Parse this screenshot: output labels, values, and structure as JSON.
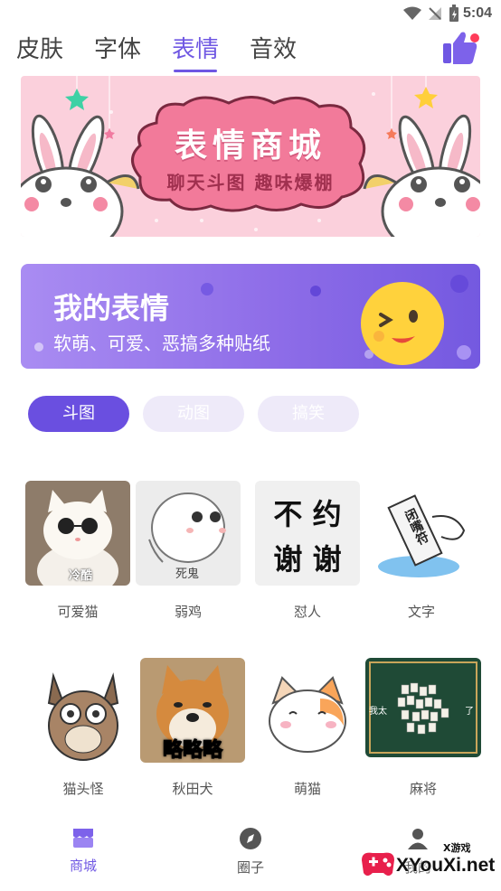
{
  "status_bar": {
    "time": "5:04"
  },
  "tabs": [
    {
      "label": "皮肤"
    },
    {
      "label": "字体"
    },
    {
      "label": "表情"
    },
    {
      "label": "音效"
    }
  ],
  "banner_shop": {
    "title": "表情商城",
    "subtitle": "聊天斗图 趣味爆棚"
  },
  "banner_mine": {
    "title": "我的表情",
    "subtitle": "软萌、可爱、恶搞多种贴纸"
  },
  "filters": [
    {
      "label": "斗图",
      "active": true
    },
    {
      "label": "动图",
      "active": false
    },
    {
      "label": "搞笑",
      "active": false
    }
  ],
  "stickers": [
    {
      "label": "可爱猫",
      "caption": "冷酷"
    },
    {
      "label": "弱鸡",
      "caption": "死鬼"
    },
    {
      "label": "怼人",
      "caption_line1": "不 约",
      "caption_line2": "谢 谢"
    },
    {
      "label": "文字",
      "caption": "闭嘴符"
    },
    {
      "label": "猫头怪"
    },
    {
      "label": "秋田犬",
      "caption": "略略略"
    },
    {
      "label": "萌猫"
    },
    {
      "label": "麻将",
      "caption_left": "我太",
      "caption_right": "了"
    }
  ],
  "bottom_nav": [
    {
      "label": "商城",
      "active": true
    },
    {
      "label": "圈子",
      "active": false
    },
    {
      "label": "我的",
      "active": false
    }
  ],
  "watermark": {
    "brand": "XYouXi.net",
    "tag": "X游戏"
  },
  "colors": {
    "accent": "#6f57e3",
    "pink": "#fbd0dc"
  }
}
